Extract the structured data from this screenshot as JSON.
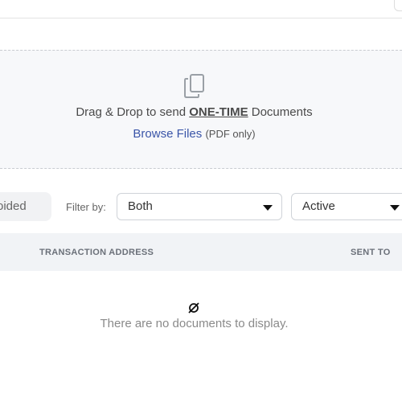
{
  "dropzone": {
    "title_prefix": "Drag & Drop to send ",
    "title_emphasis": "ONE-TIME",
    "title_suffix": " Documents",
    "browse_label": "Browse Files",
    "browse_hint": "(PDF only)",
    "icon": "document-copy-icon"
  },
  "filters": {
    "status_chip": "oided",
    "filter_label": "Filter by:",
    "filter_value": "Both",
    "state_value": "Active"
  },
  "table": {
    "columns": [
      "TRANSACTION ADDRESS",
      "SENT TO"
    ],
    "empty_message": "There are no documents to display.",
    "empty_icon": "empty-set-icon"
  }
}
